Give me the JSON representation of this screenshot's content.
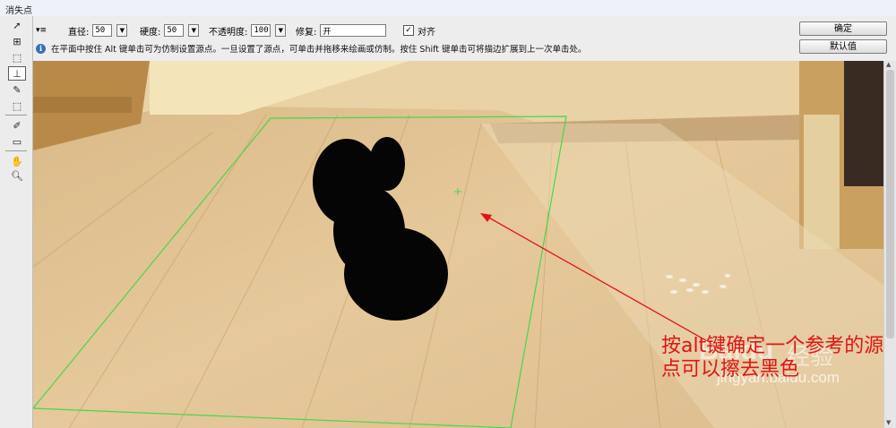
{
  "window": {
    "title": "消失点"
  },
  "options": {
    "diameter_label": "直径:",
    "diameter_value": "50",
    "hardness_label": "硬度:",
    "hardness_value": "50",
    "opacity_label": "不透明度:",
    "opacity_value": "100",
    "heal_label": "修复:",
    "heal_value": "开",
    "align_label": "对齐",
    "align_checked": true
  },
  "info": {
    "text": "在平面中按住 Alt 键单击可为仿制设置源点。一旦设置了源点，可单击并拖移来绘画或仿制。按住 Shift 键单击可将描边扩展到上一次单击处。"
  },
  "buttons": {
    "ok": "确定",
    "default": "默认值"
  },
  "tools": [
    "edit-plane-tool",
    "create-plane-tool",
    "marquee-tool",
    "stamp-tool",
    "brush-tool",
    "transform-tool",
    "eyedropper-tool",
    "measure-tool",
    "hand-tool",
    "zoom-tool"
  ],
  "annotation": {
    "text": "按alt键确定一个参考的源点可以擦去黑色",
    "color": "#e01515"
  },
  "watermark": {
    "logo": "Baidu",
    "cn": "经验",
    "url": "jingyan.baidu.com"
  },
  "colors": {
    "plane_grid": "#49d64a",
    "arrow": "#e01515"
  }
}
